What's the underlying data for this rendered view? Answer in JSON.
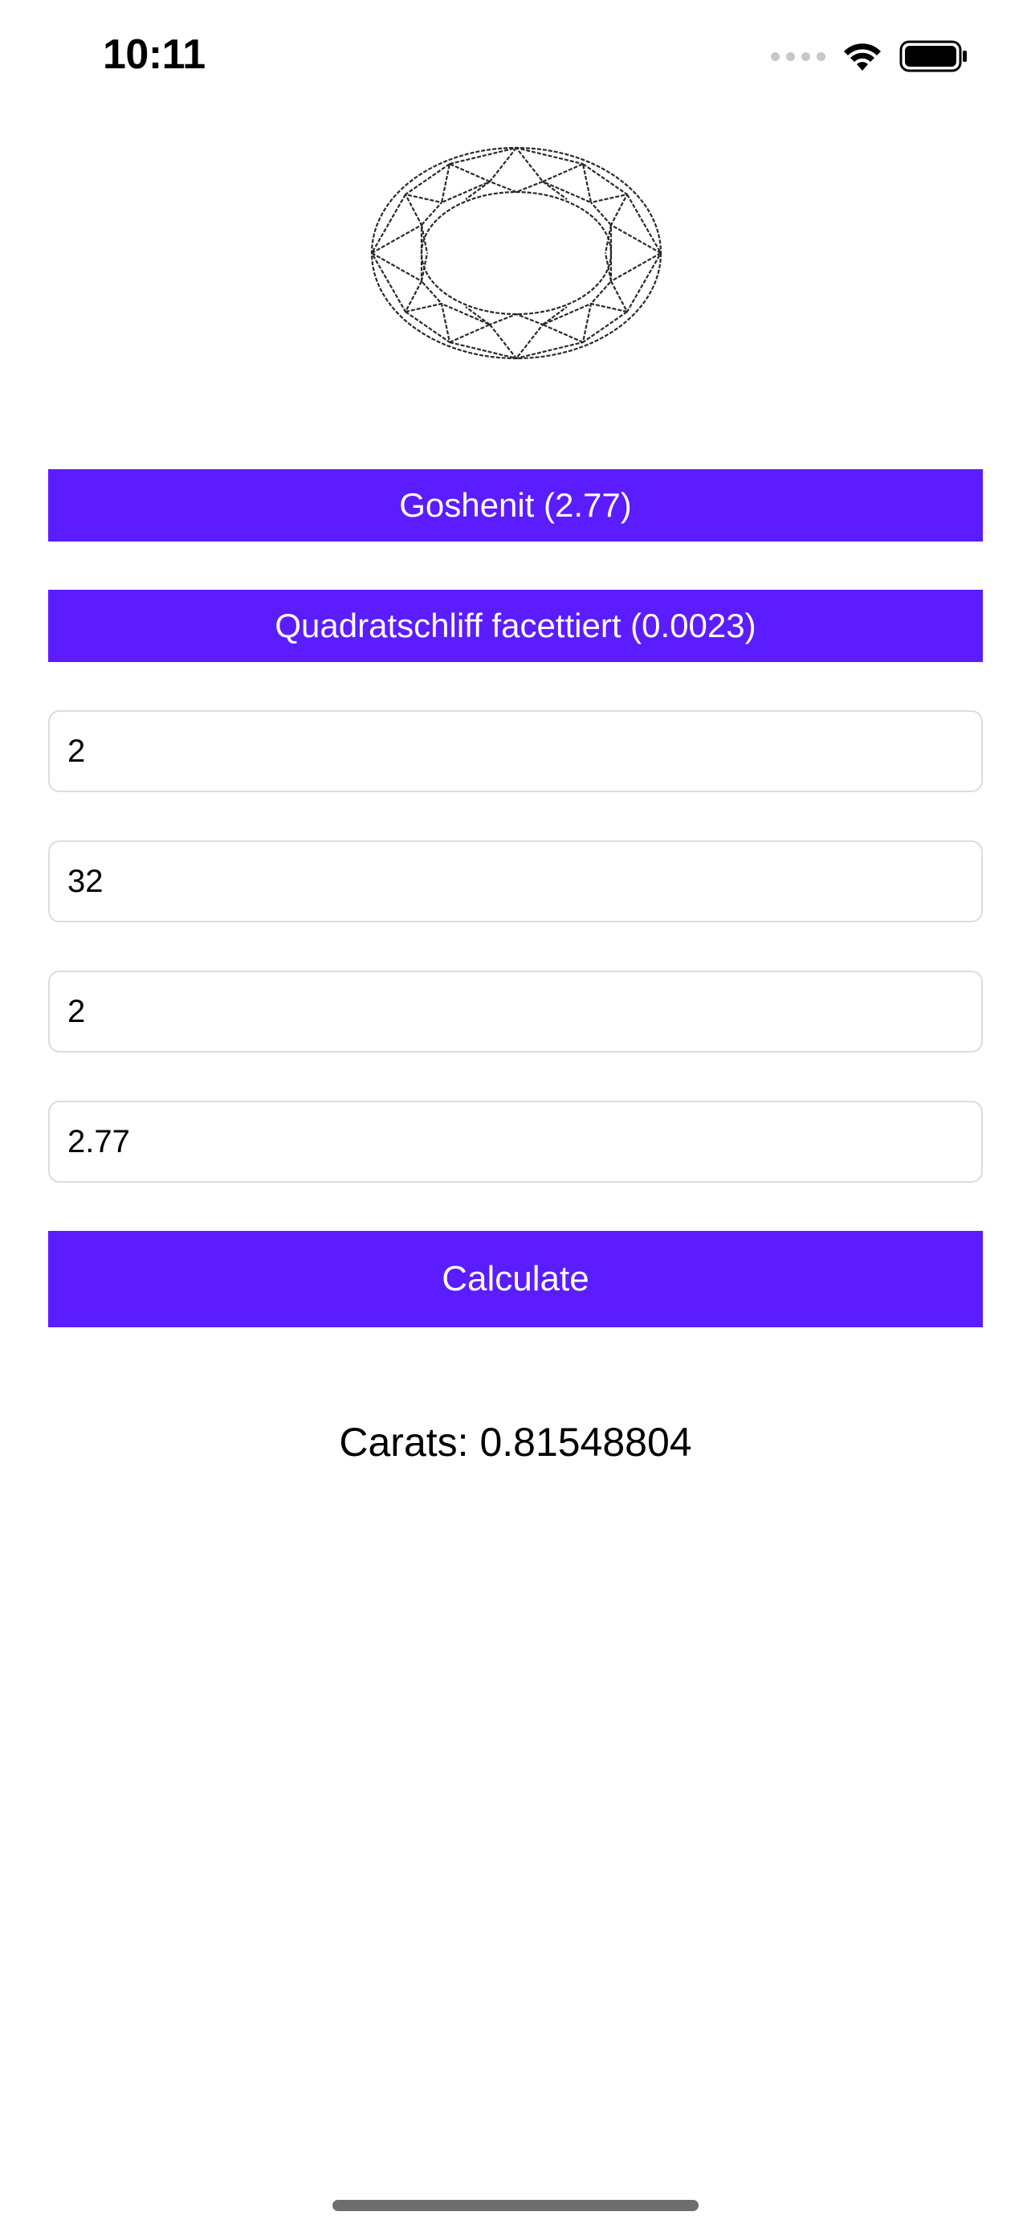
{
  "status_bar": {
    "time": "10:11"
  },
  "gem": {
    "icon": "oval-gem-facet-icon"
  },
  "selectors": {
    "material": "Goshenit (2.77)",
    "cut": "Quadratschliff facettiert (0.0023)"
  },
  "inputs": {
    "field_1": "2",
    "field_2": "32",
    "field_3": "2",
    "field_4": "2.77"
  },
  "actions": {
    "calculate_label": "Calculate"
  },
  "result": {
    "text": "Carats: 0.81548804"
  },
  "colors": {
    "accent": "#5b1cff",
    "text": "#000000",
    "field_border": "#dcdcdc"
  }
}
